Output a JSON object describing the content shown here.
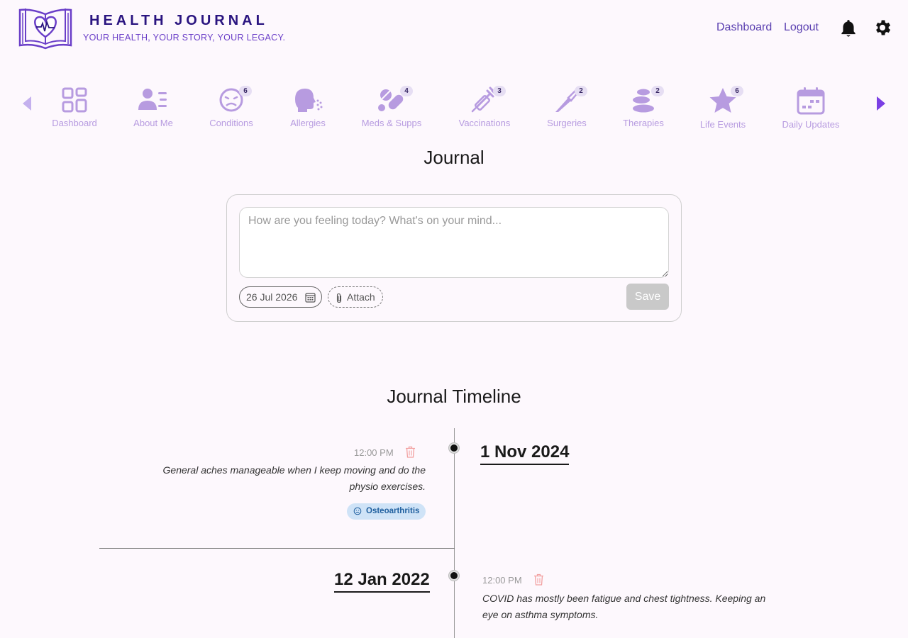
{
  "header": {
    "title": "HEALTH JOURNAL",
    "tagline": "YOUR HEALTH, YOUR STORY, YOUR LEGACY.",
    "links": {
      "dashboard": "Dashboard",
      "logout": "Logout"
    },
    "icons": [
      "book-heart-logo-icon",
      "bell-icon",
      "gear-icon"
    ]
  },
  "categories": [
    {
      "label": "Dashboard",
      "icon": "grid-icon",
      "badge": ""
    },
    {
      "label": "About Me",
      "icon": "person-card-icon",
      "badge": ""
    },
    {
      "label": "Conditions",
      "icon": "sick-face-icon",
      "badge": "6"
    },
    {
      "label": "Allergies",
      "icon": "sneeze-head-icon",
      "badge": ""
    },
    {
      "label": "Meds & Supps",
      "icon": "pills-icon",
      "badge": "4"
    },
    {
      "label": "Vaccinations",
      "icon": "syringe-icon",
      "badge": "3"
    },
    {
      "label": "Surgeries",
      "icon": "scalpel-icon",
      "badge": "2"
    },
    {
      "label": "Therapies",
      "icon": "stones-icon",
      "badge": "2"
    },
    {
      "label": "Life Events",
      "icon": "star-icon",
      "badge": "6"
    },
    {
      "label": "Daily Updates",
      "icon": "calendar-icon",
      "badge": ""
    }
  ],
  "journal": {
    "title": "Journal",
    "placeholder": "How are you feeling today? What's on your mind...",
    "date": "26 Jul 2026",
    "attach": "Attach",
    "save": "Save"
  },
  "timeline": {
    "title": "Journal Timeline",
    "entries": [
      {
        "date": "1 Nov 2024",
        "time": "12:00 PM",
        "text": "General aches manageable when I keep moving and do the physio exercises.",
        "tag": "Osteoarthritis"
      },
      {
        "date": "12 Jan 2022",
        "time": "12:00 PM",
        "text": "COVID has mostly been fatigue and chest tightness. Keeping an eye on asthma symptoms."
      }
    ]
  },
  "colors": {
    "accent": "#7b3fe4",
    "category": "#b79be0",
    "brand": "#2a1580",
    "background": "#fdf8fd"
  }
}
